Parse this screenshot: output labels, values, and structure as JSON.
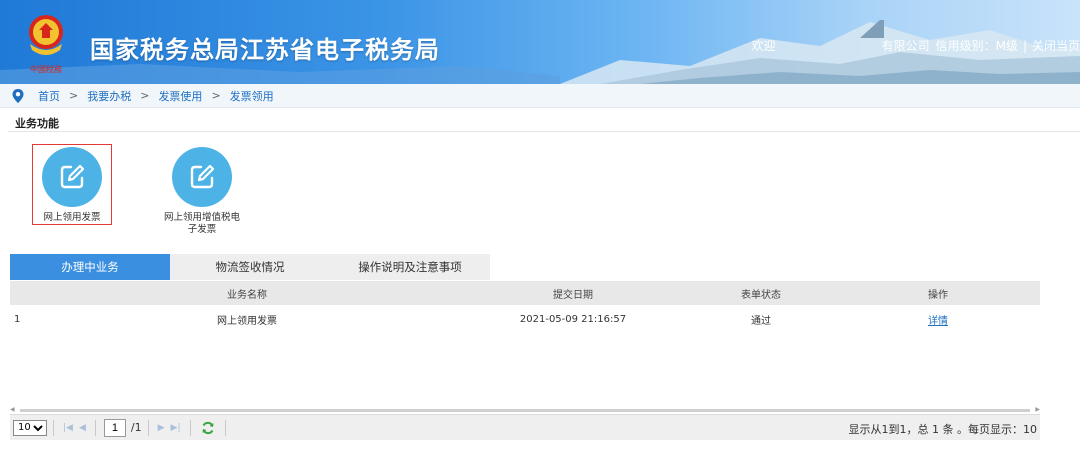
{
  "header": {
    "title": "国家税务总局江苏省电子税务局",
    "emblem_text": "中國稅務",
    "welcome_prefix": "欢迎",
    "company_suffix": "有限公司",
    "credit_label": "信用级别：M级",
    "separator": "|",
    "close_label": "关闭当页"
  },
  "breadcrumb": {
    "items": [
      "首页",
      "我要办税",
      "发票使用",
      "发票领用"
    ],
    "arrow": ">"
  },
  "section": {
    "title": "业务功能"
  },
  "tiles": [
    {
      "label": "网上领用发票",
      "icon": "edit-icon",
      "selected": true
    },
    {
      "label": "网上领用增值税电子发票",
      "icon": "edit-icon",
      "selected": false
    }
  ],
  "tabs": [
    {
      "label": "办理中业务",
      "active": true
    },
    {
      "label": "物流签收情况",
      "active": false
    },
    {
      "label": "操作说明及注意事项",
      "active": false
    }
  ],
  "table": {
    "headers": [
      "",
      "业务名称",
      "提交日期",
      "表单状态",
      "操作"
    ],
    "rows": [
      {
        "index": "1",
        "name": "网上领用发票",
        "date": "2021-05-09 21:16:57",
        "status": "通过",
        "action": "详情"
      }
    ]
  },
  "pager": {
    "page_size": "10",
    "current_page": "1",
    "total_pages": "/1",
    "info": "显示从1到1，总 1 条 。每页显示：10"
  },
  "colors": {
    "accent": "#3a8fe0",
    "tile_circle": "#4db3e6",
    "selected_border": "#e53935",
    "link": "#1e6fc2"
  }
}
